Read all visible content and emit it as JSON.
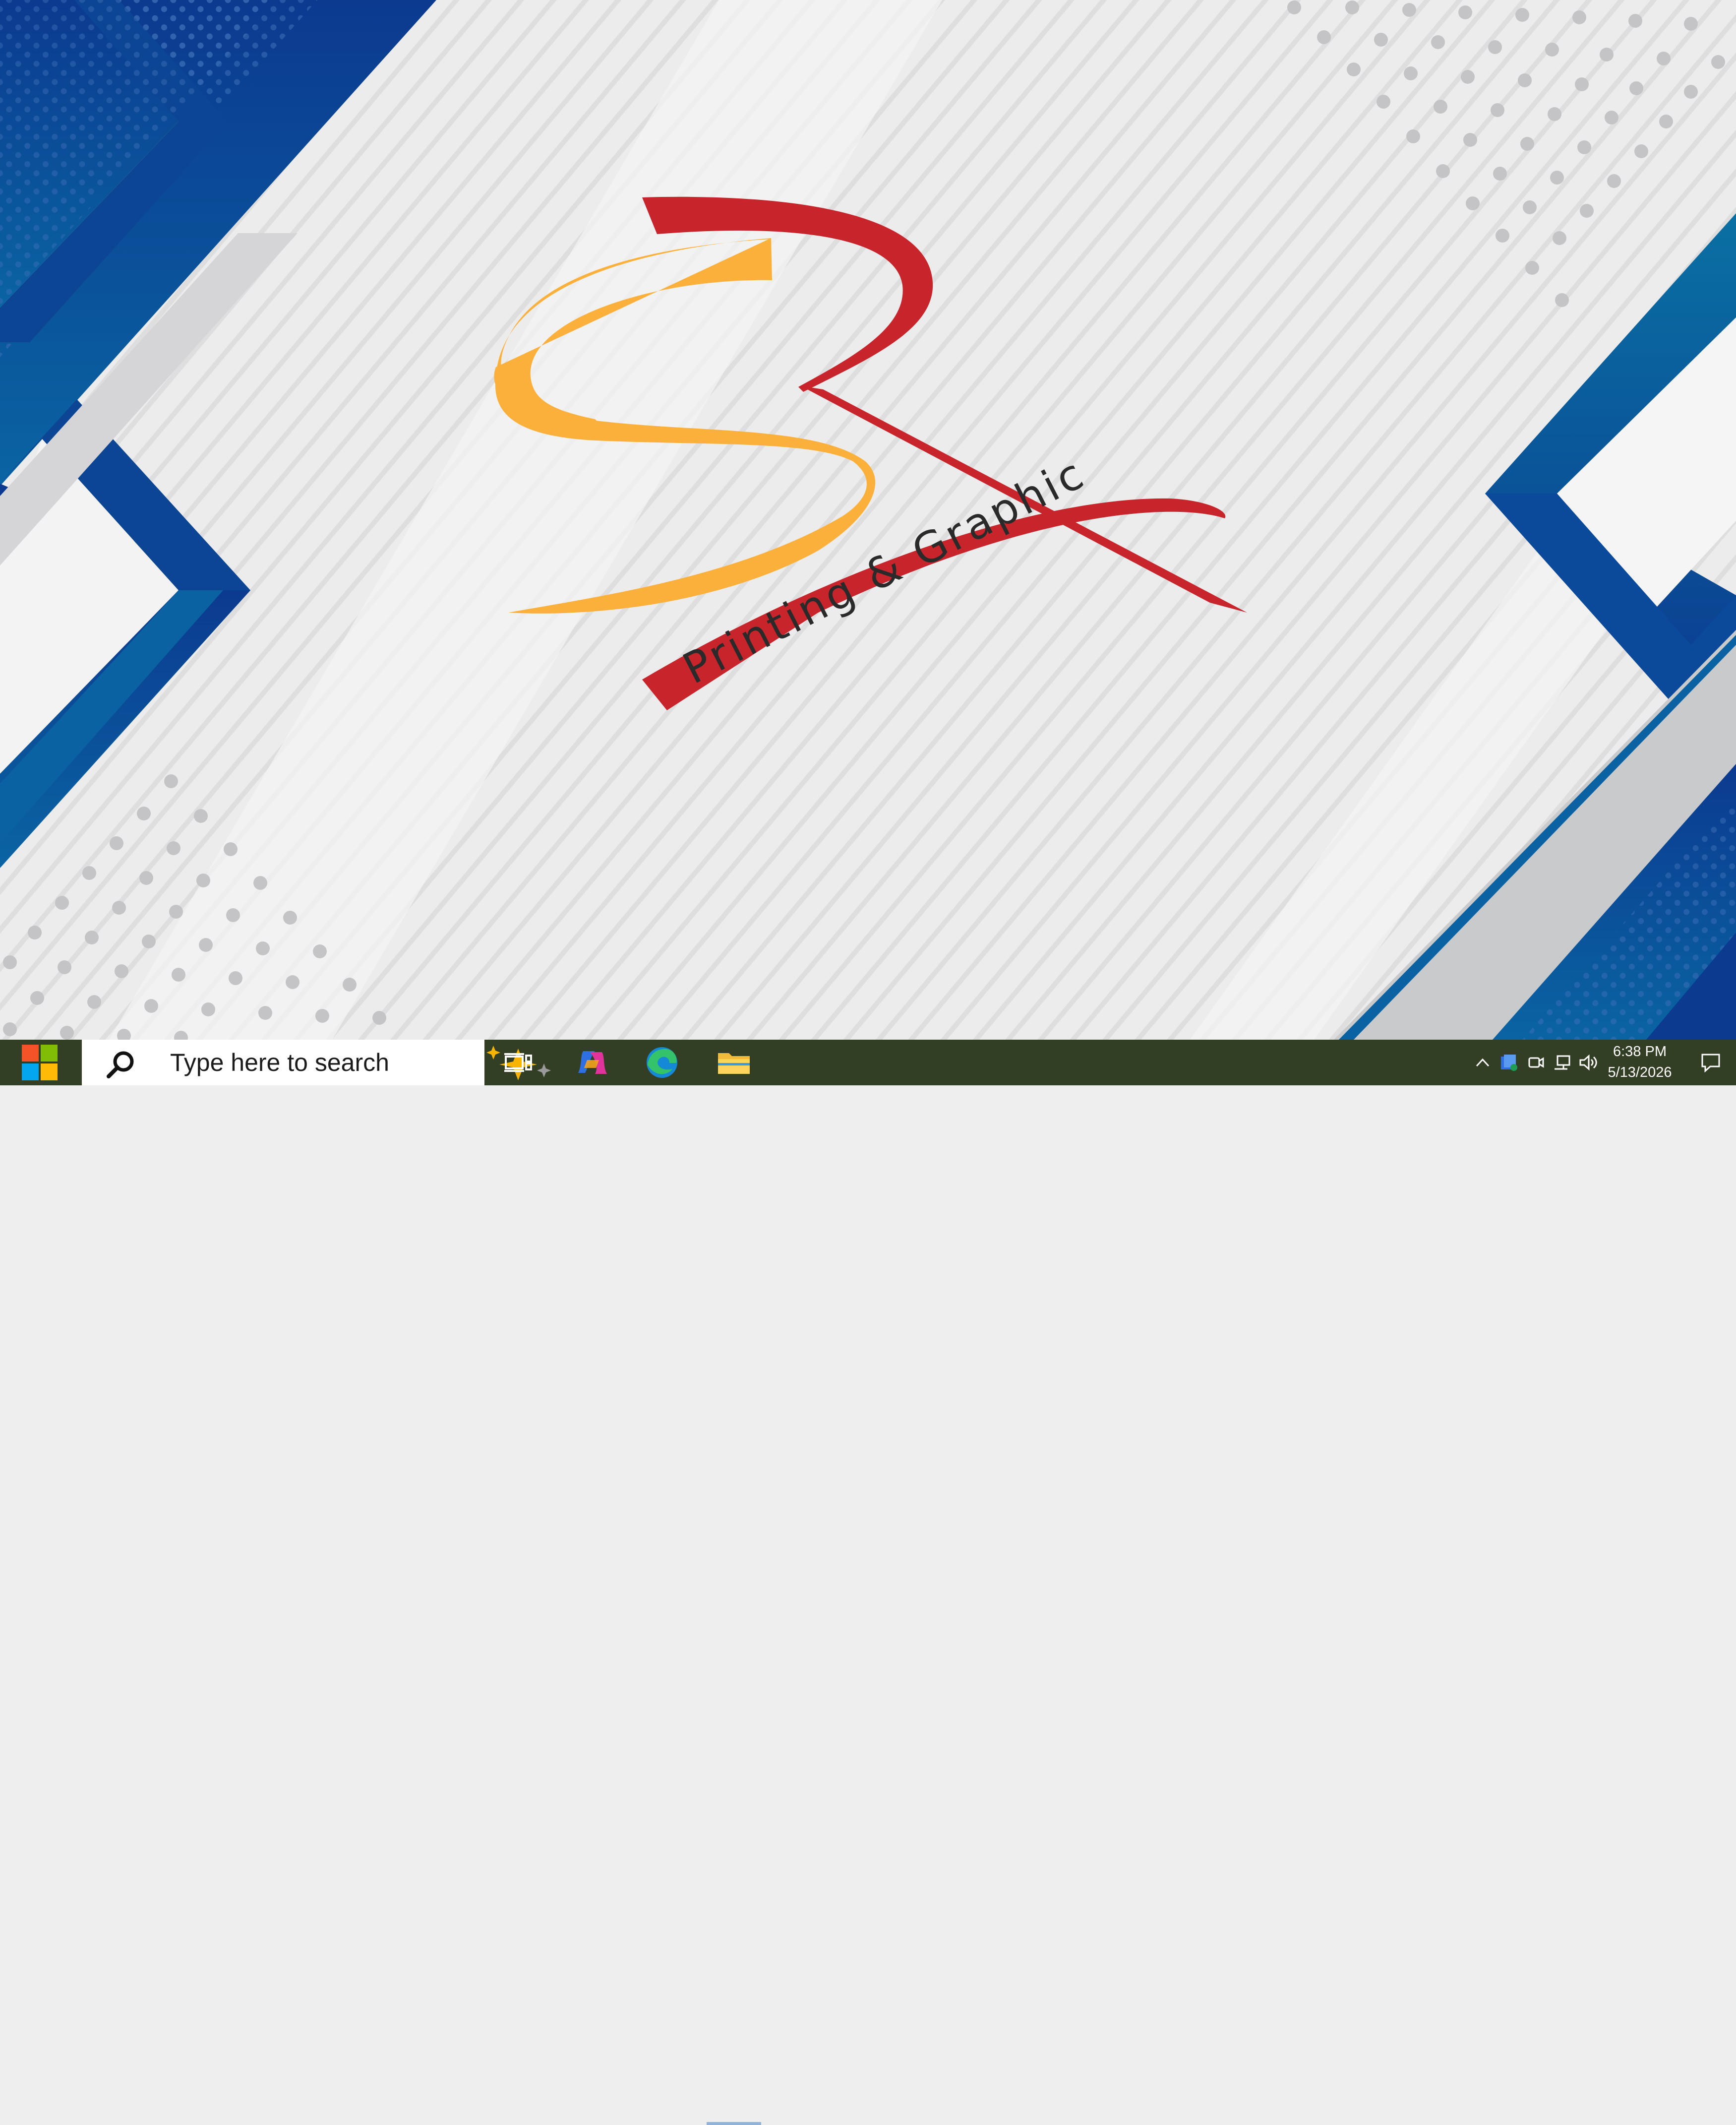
{
  "wallpaper": {
    "logo_caption": "Printing & Graphic",
    "colors": {
      "background": "#eeeeee",
      "stripe": "#d9d9d9",
      "blue_dark": "#0b3d91",
      "blue_mid": "#0a5aa6",
      "teal": "#0a6ea3",
      "gray_band": "#c9c9cc",
      "dots": "#c2c2c4",
      "logo_red": "#c8242b",
      "logo_yellow": "#fbb03b"
    }
  },
  "taskbar": {
    "start_icon": "windows-logo-icon",
    "search": {
      "placeholder": "Type here to search",
      "icon": "search-icon",
      "highlight_icon": "sparkle-highlight-icon"
    },
    "pinned": [
      {
        "name": "Task View",
        "icon": "task-view-icon"
      },
      {
        "name": "Copilot",
        "icon": "copilot-icon"
      },
      {
        "name": "Microsoft Edge",
        "icon": "edge-icon"
      },
      {
        "name": "File Explorer",
        "icon": "folder-icon",
        "active": true
      }
    ],
    "tray": {
      "icons": [
        "chevron-up-icon",
        "onedrive-sync-icon",
        "meet-now-icon",
        "network-icon",
        "volume-icon"
      ],
      "time": "6:38 PM",
      "date": "5/13/2026",
      "notifications_icon": "notification-icon"
    },
    "background": "#333f24"
  }
}
